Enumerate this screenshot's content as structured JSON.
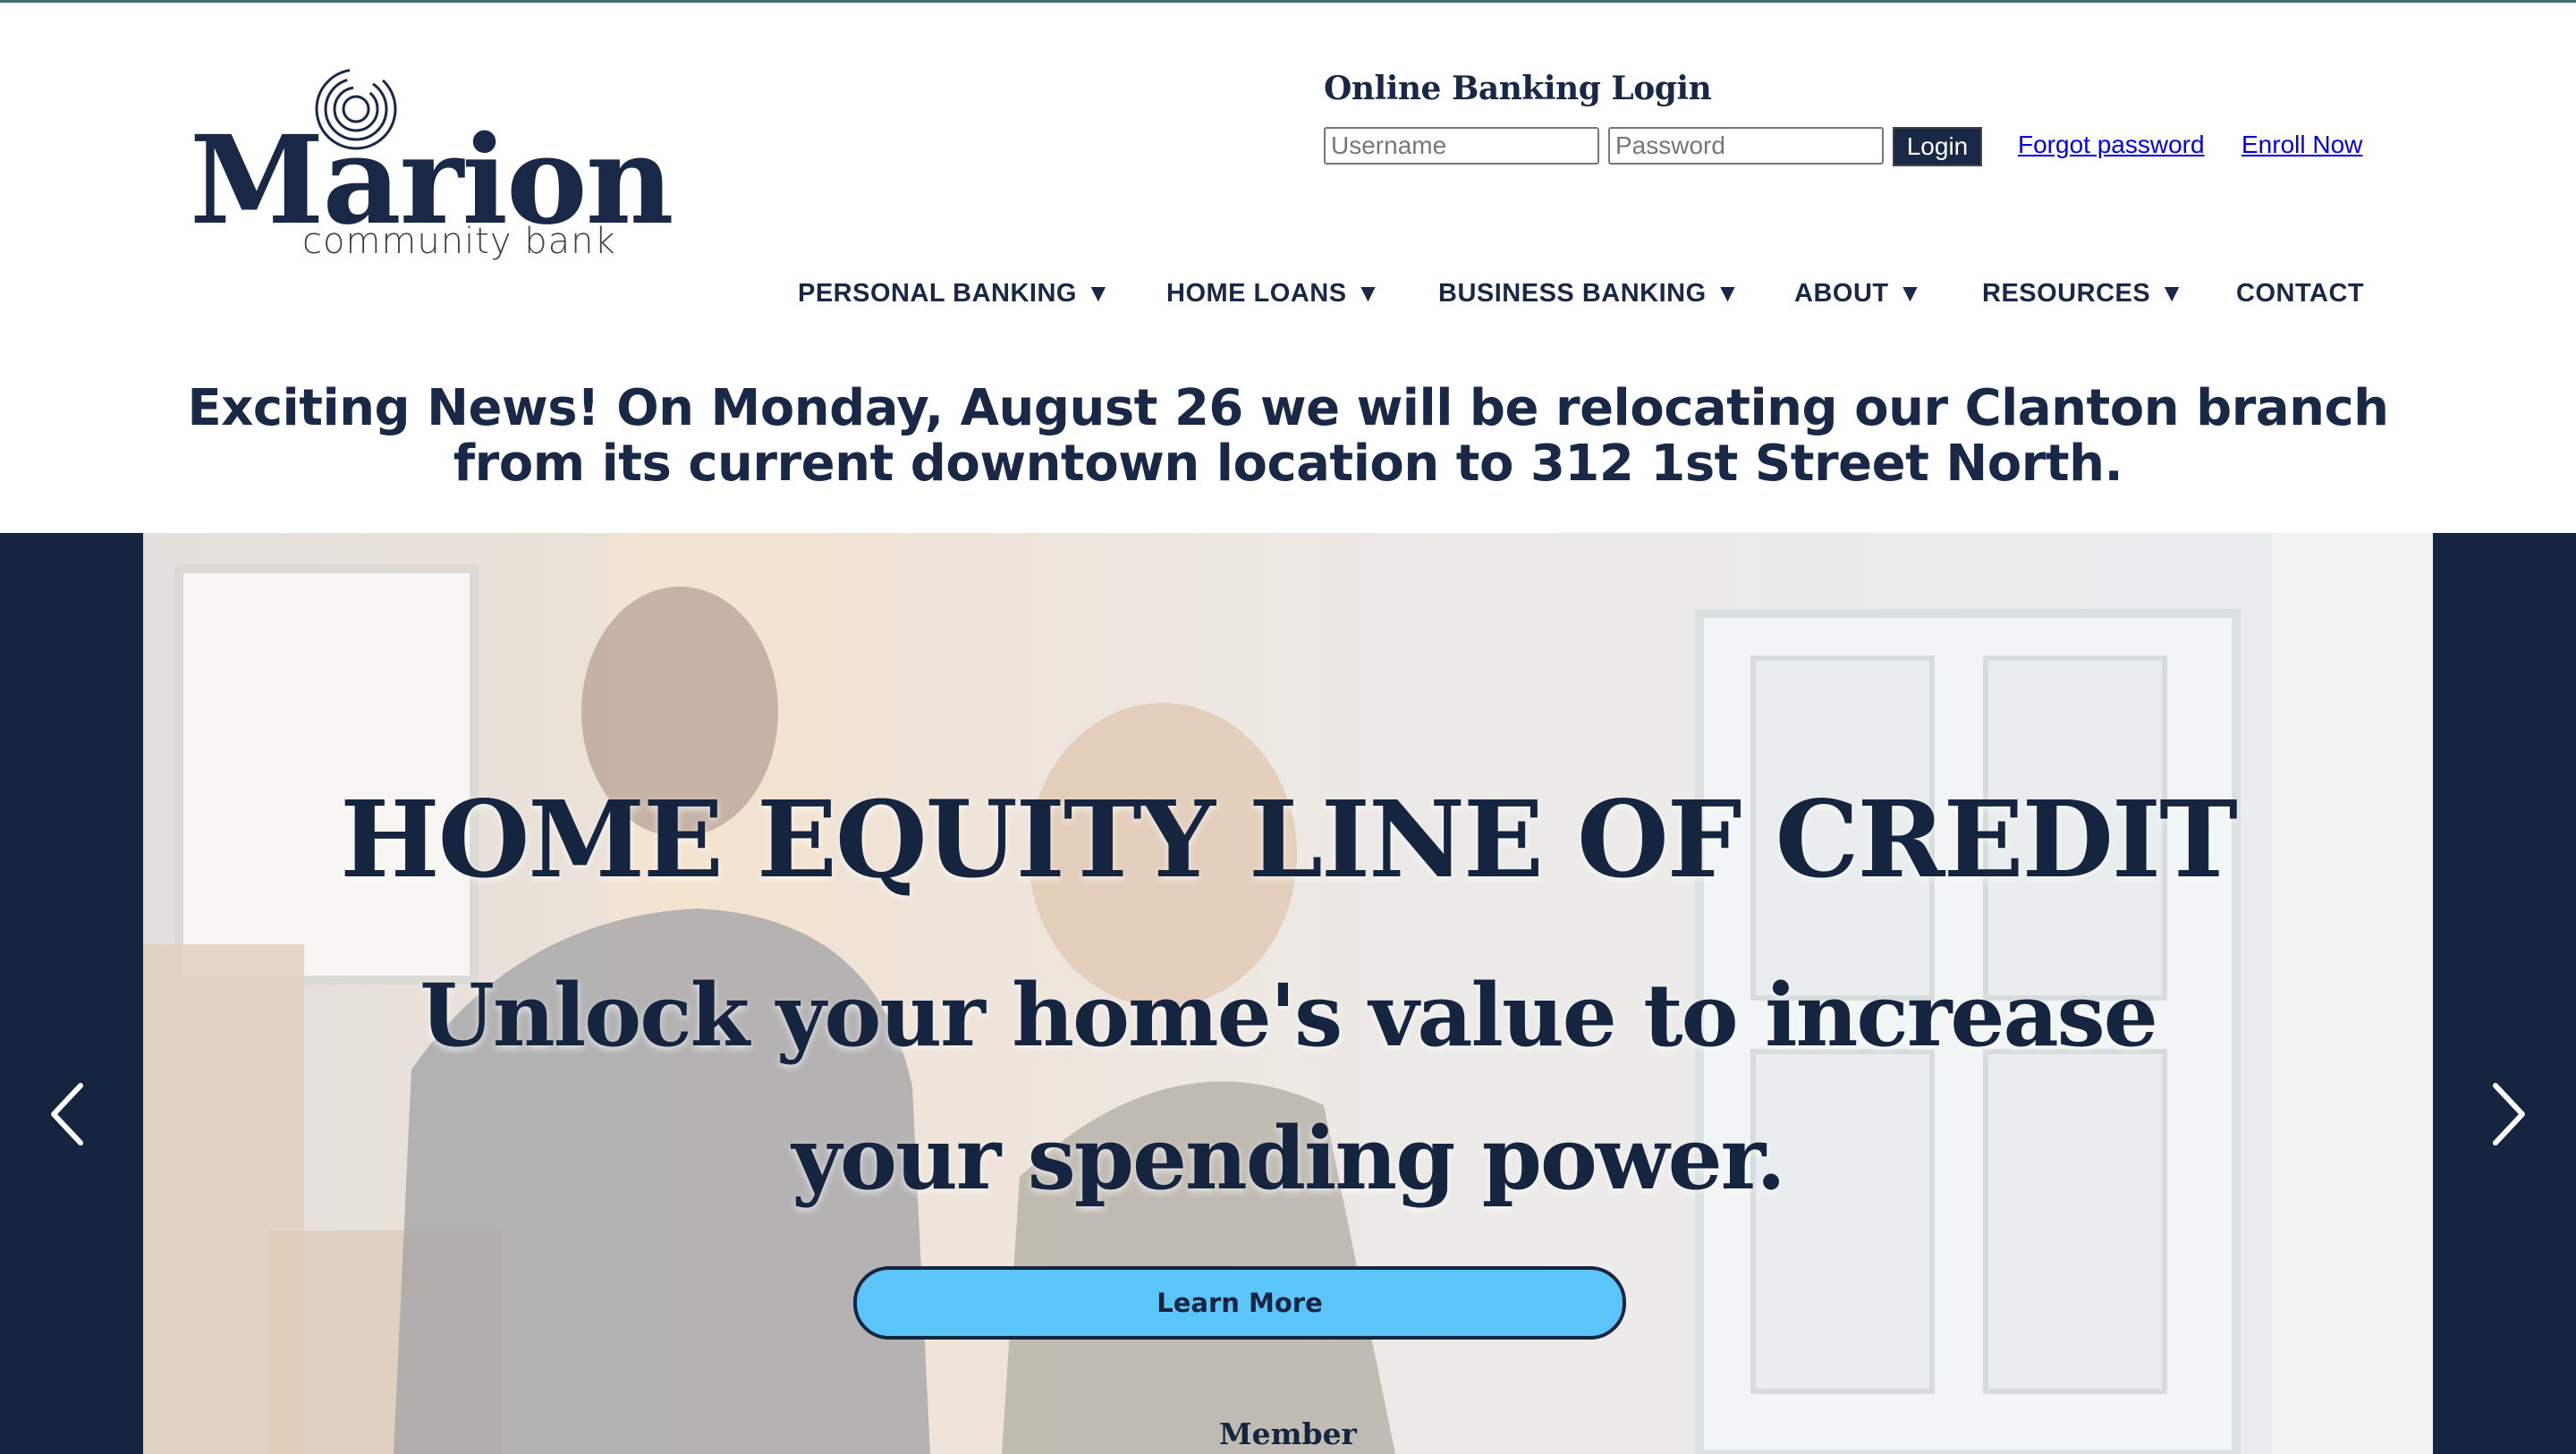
{
  "colors": {
    "brand_navy": "#1a2848",
    "hero_band": "#15243f",
    "cta_blue": "#5bc4f8",
    "link_blue": "#0000ee",
    "top_rule": "#3e6f7a"
  },
  "logo": {
    "name": "Marion",
    "tagline": "community bank",
    "icon": "concentric-circles-logo-icon"
  },
  "login": {
    "title": "Online Banking Login",
    "username_placeholder": "Username",
    "username_value": "",
    "password_placeholder": "Password",
    "password_value": "",
    "button_label": "Login",
    "forgot_label": "Forgot password",
    "enroll_label": "Enroll Now"
  },
  "nav": {
    "caret": "▼",
    "items": [
      {
        "label": "PERSONAL BANKING",
        "has_dropdown": true
      },
      {
        "label": "HOME LOANS",
        "has_dropdown": true
      },
      {
        "label": "BUSINESS BANKING",
        "has_dropdown": true
      },
      {
        "label": "ABOUT",
        "has_dropdown": true
      },
      {
        "label": "RESOURCES",
        "has_dropdown": true
      },
      {
        "label": "CONTACT",
        "has_dropdown": false
      }
    ]
  },
  "announcement": {
    "text": "Exciting News! On Monday, August 26 we will be relocating our Clanton branch from its current downtown location to 312 1st Street North."
  },
  "hero": {
    "title": "HOME EQUITY LINE OF CREDIT",
    "subtitle": "Unlock your home's value to increase your spending power.",
    "button_label": "Learn More",
    "footer_text": "Member",
    "prev_icon": "chevron-left-icon",
    "next_icon": "chevron-right-icon"
  }
}
